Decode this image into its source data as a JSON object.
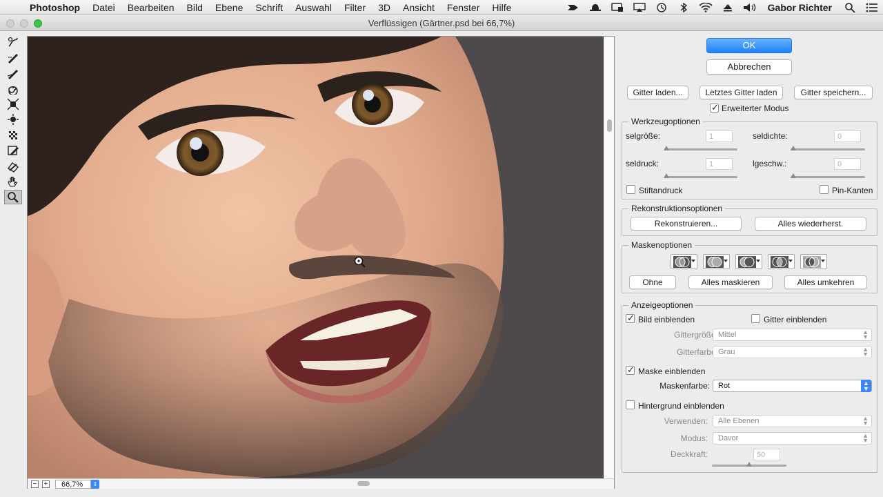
{
  "menubar": {
    "app": "Photoshop",
    "items": [
      "Datei",
      "Bearbeiten",
      "Bild",
      "Ebene",
      "Schrift",
      "Auswahl",
      "Filter",
      "3D",
      "Ansicht",
      "Fenster",
      "Hilfe"
    ],
    "user": "Gabor Richter"
  },
  "window": {
    "title": "Verflüssigen (Gärtner.psd bei 66,7%)"
  },
  "canvas": {
    "zoom": "66,7%"
  },
  "panel": {
    "ok": "OK",
    "cancel": "Abbrechen",
    "mesh_load": "Gitter laden...",
    "mesh_last": "Letztes Gitter laden",
    "mesh_save": "Gitter speichern...",
    "advanced_mode": "Erweiterter Modus",
    "tool_options": {
      "legend": "Werkzeugoptionen",
      "brush_size": "selgröße:",
      "brush_size_value": "1",
      "brush_density": "seldichte:",
      "brush_density_value": "0",
      "brush_pressure": "seldruck:",
      "brush_pressure_value": "1",
      "brush_rate": "lgeschw.:",
      "brush_rate_value": "0",
      "stylus": "Stiftandruck",
      "pin_edges": "Pin-Kanten"
    },
    "reconstruct": {
      "legend": "Rekonstruktionsoptionen",
      "reconstruct_btn": "Rekonstruieren...",
      "restore_all_btn": "Alles wiederherst."
    },
    "mask": {
      "legend": "Maskenoptionen",
      "none_btn": "Ohne",
      "mask_all_btn": "Alles maskieren",
      "invert_all_btn": "Alles umkehren"
    },
    "view": {
      "legend": "Anzeigeoptionen",
      "show_image": "Bild einblenden",
      "show_mesh": "Gitter einblenden",
      "mesh_size_label": "Gittergröße:",
      "mesh_size_value": "Mittel",
      "mesh_color_label": "Gitterfarbe:",
      "mesh_color_value": "Grau",
      "show_mask": "Maske einblenden",
      "mask_color_label": "Maskenfarbe:",
      "mask_color_value": "Rot",
      "show_backdrop": "Hintergrund einblenden",
      "use_label": "Verwenden:",
      "use_value": "Alle Ebenen",
      "mode_label": "Modus:",
      "mode_value": "Davor",
      "opacity_label": "Deckkraft:",
      "opacity_value": "50"
    }
  },
  "colors": {
    "accent": "#1a82fb",
    "background": "#ececec",
    "photo_bg": "#4d4849"
  }
}
